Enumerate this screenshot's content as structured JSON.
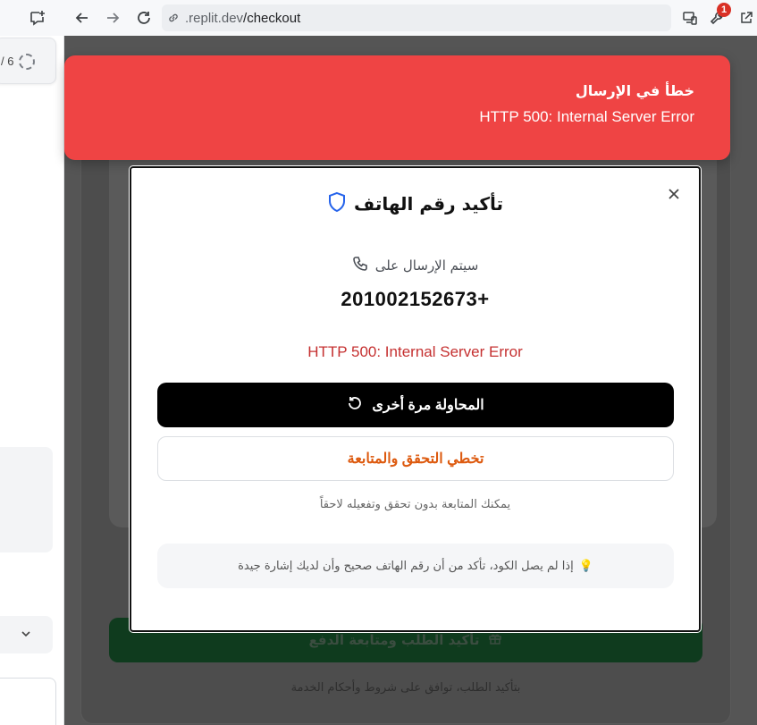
{
  "browser": {
    "url_host": ".replit.dev",
    "url_path": "/checkout",
    "notification_count": "1"
  },
  "side_panel": {
    "counter_text": "/ 6"
  },
  "toast": {
    "title": "خطأ في الإرسال",
    "message": "HTTP 500: Internal Server Error",
    "color": "#ef4444"
  },
  "modal": {
    "title": "تأكيد رقم الهاتف",
    "send_to_label": "سيتم الإرسال على",
    "phone_number": "+201002152673",
    "error_text": "HTTP 500: Internal Server Error",
    "retry_label": "المحاولة مرة أخرى",
    "skip_label": "تخطي التحقق والمتابعة",
    "note": "يمكنك المتابعة بدون تحقق وتفعيله لاحقاً",
    "tip": "إذا لم يصل الكود، تأكد من أن رقم الهاتف صحيح وأن لديك إشارة جيدة",
    "tip_icon": "💡",
    "accent_orange": "#dd5a0f",
    "error_red": "#c53030"
  },
  "background": {
    "confirm_button": "تأكيد الطلب ومتابعة الدفع",
    "terms_text": "بتأكيد الطلب، توافق على شروط وأحكام الخدمة"
  }
}
